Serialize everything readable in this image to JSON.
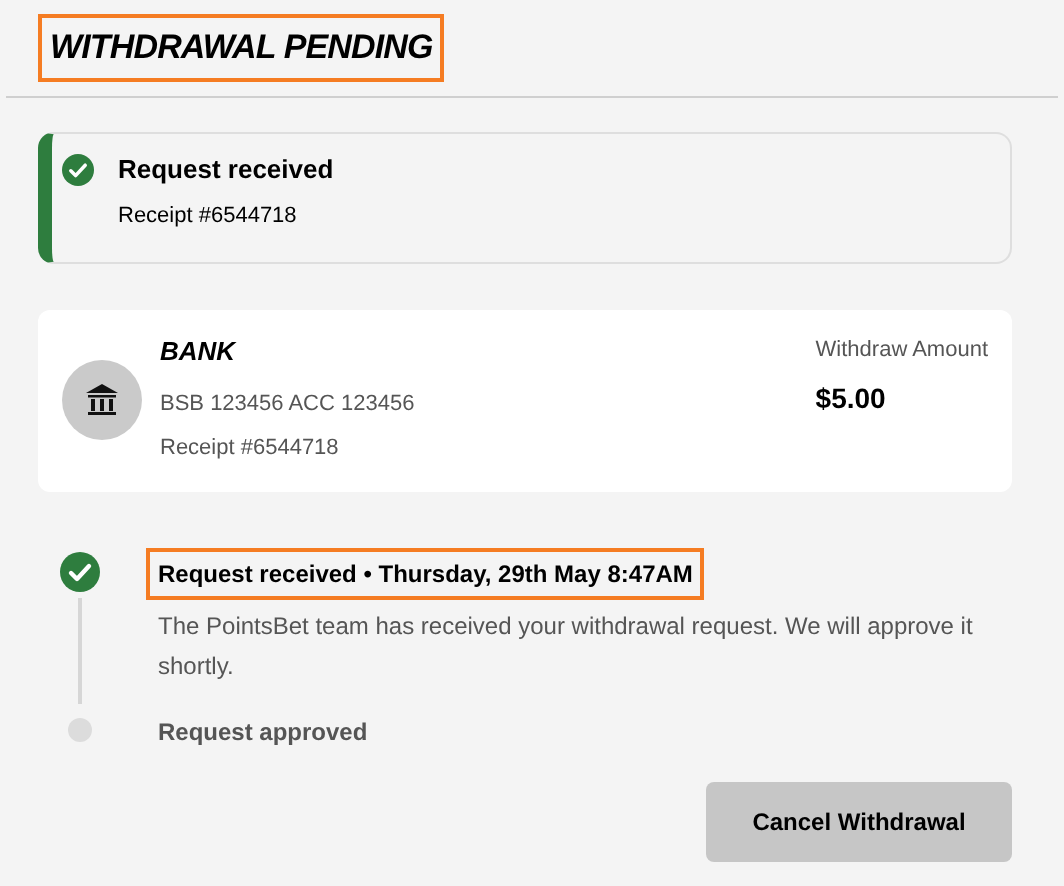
{
  "title": {
    "text": "WITHDRAWAL PENDING",
    "highlighted": true
  },
  "status": {
    "title": "Request received",
    "receipt": "Receipt #6544718",
    "done": true
  },
  "method": {
    "name": "BANK",
    "account": "BSB 123456 ACC 123456",
    "receipt": "Receipt #6544718",
    "amount_label": "Withdraw Amount",
    "amount": "$5.00"
  },
  "steps": [
    {
      "title": "Request received • Thursday, 29th May 8:47AM",
      "description": "The PointsBet team has received your withdrawal request. We will approve it shortly.",
      "completed": true,
      "highlighted": true
    },
    {
      "title": "Request approved",
      "completed": false,
      "highlighted": false
    }
  ],
  "buttons": [
    "Cancel Withdrawal"
  ]
}
